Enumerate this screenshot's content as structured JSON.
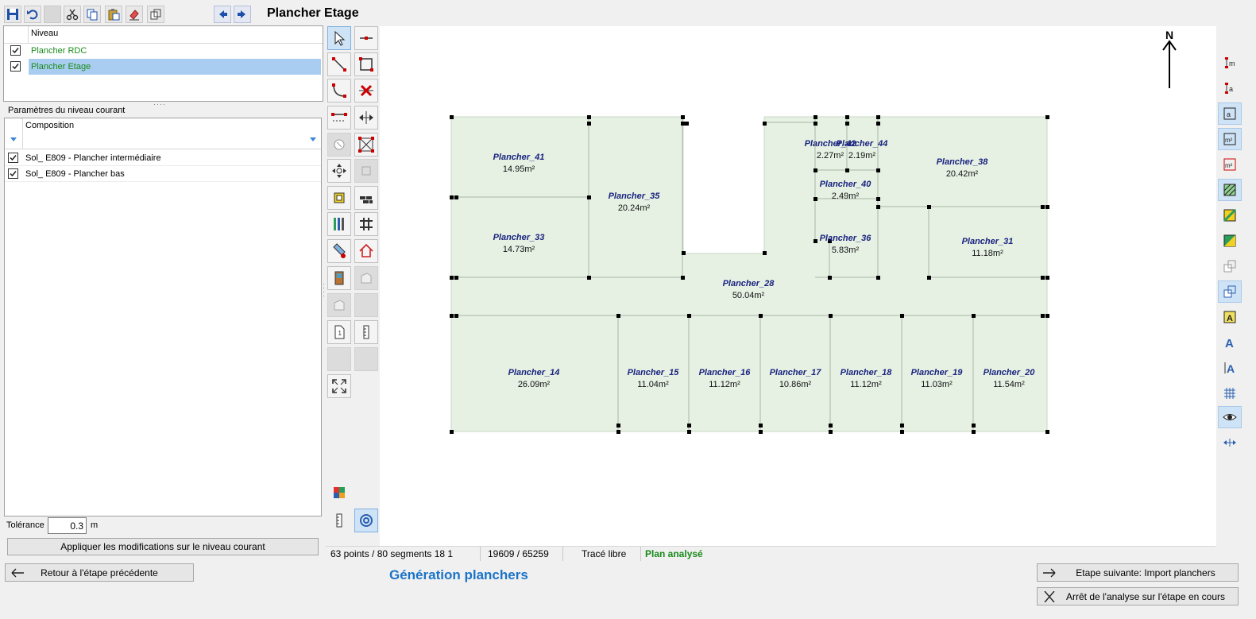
{
  "window": {
    "title": "Plancher Etage"
  },
  "niveaux": {
    "header": "Niveau",
    "items": [
      {
        "label": "Plancher RDC",
        "checked": true
      },
      {
        "label": "Plancher Etage",
        "checked": true,
        "selected": true
      }
    ]
  },
  "params": {
    "section_title": "Paramètres du niveau courant",
    "column_header": "Composition",
    "items": [
      {
        "label": "Sol_ E809 - Plancher intermédiaire",
        "checked": true
      },
      {
        "label": "Sol_ E809 - Plancher bas",
        "checked": true
      }
    ],
    "tolerance_label": "Tolérance",
    "tolerance_value": "0.3",
    "tolerance_unit": "m",
    "apply_label": "Appliquer les modifications sur le niveau courant"
  },
  "north_label": "N",
  "rooms": [
    {
      "name": "Plancher_41",
      "area": "14.95m²"
    },
    {
      "name": "Plancher_35",
      "area": "20.24m²"
    },
    {
      "name": "Plancher_33",
      "area": "14.73m²"
    },
    {
      "name": "Plancher_42",
      "area": "2.27m²"
    },
    {
      "name": "Plancher_44",
      "area": "2.19m²"
    },
    {
      "name": "Plancher_38",
      "area": "20.42m²"
    },
    {
      "name": "Plancher_40",
      "area": "2.49m²"
    },
    {
      "name": "Plancher_36",
      "area": "5.83m²"
    },
    {
      "name": "Plancher_31",
      "area": "11.18m²"
    },
    {
      "name": "Plancher_28",
      "area": "50.04m²"
    },
    {
      "name": "Plancher_14",
      "area": "26.09m²"
    },
    {
      "name": "Plancher_15",
      "area": "11.04m²"
    },
    {
      "name": "Plancher_16",
      "area": "11.12m²"
    },
    {
      "name": "Plancher_17",
      "area": "10.86m²"
    },
    {
      "name": "Plancher_18",
      "area": "11.12m²"
    },
    {
      "name": "Plancher_19",
      "area": "11.03m²"
    },
    {
      "name": "Plancher_20",
      "area": "11.54m²"
    }
  ],
  "status": {
    "points": "63 points / 80 segments 18 1",
    "coords": "19609 / 65259",
    "mode": "Tracé libre",
    "state": "Plan analysé"
  },
  "footer": {
    "back_label": "Retour à l'étape précédente",
    "step_title": "Génération planchers",
    "next_label": "Etape suivante: Import planchers",
    "stop_label": "Arrêt de l'analyse sur l'étape en cours"
  },
  "colors": {
    "floor_fill": "#e6f1e4",
    "room_label": "#1a237e",
    "accent": "#1a73c8",
    "ok_green": "#1a8a1a",
    "selection": "#a9cdf0"
  },
  "icons": [
    "save-icon",
    "undo-icon",
    "cut-icon",
    "copy-icon",
    "paste-icon",
    "eraser-icon",
    "layers-icon",
    "arrow-left-icon",
    "arrow-right-icon"
  ]
}
